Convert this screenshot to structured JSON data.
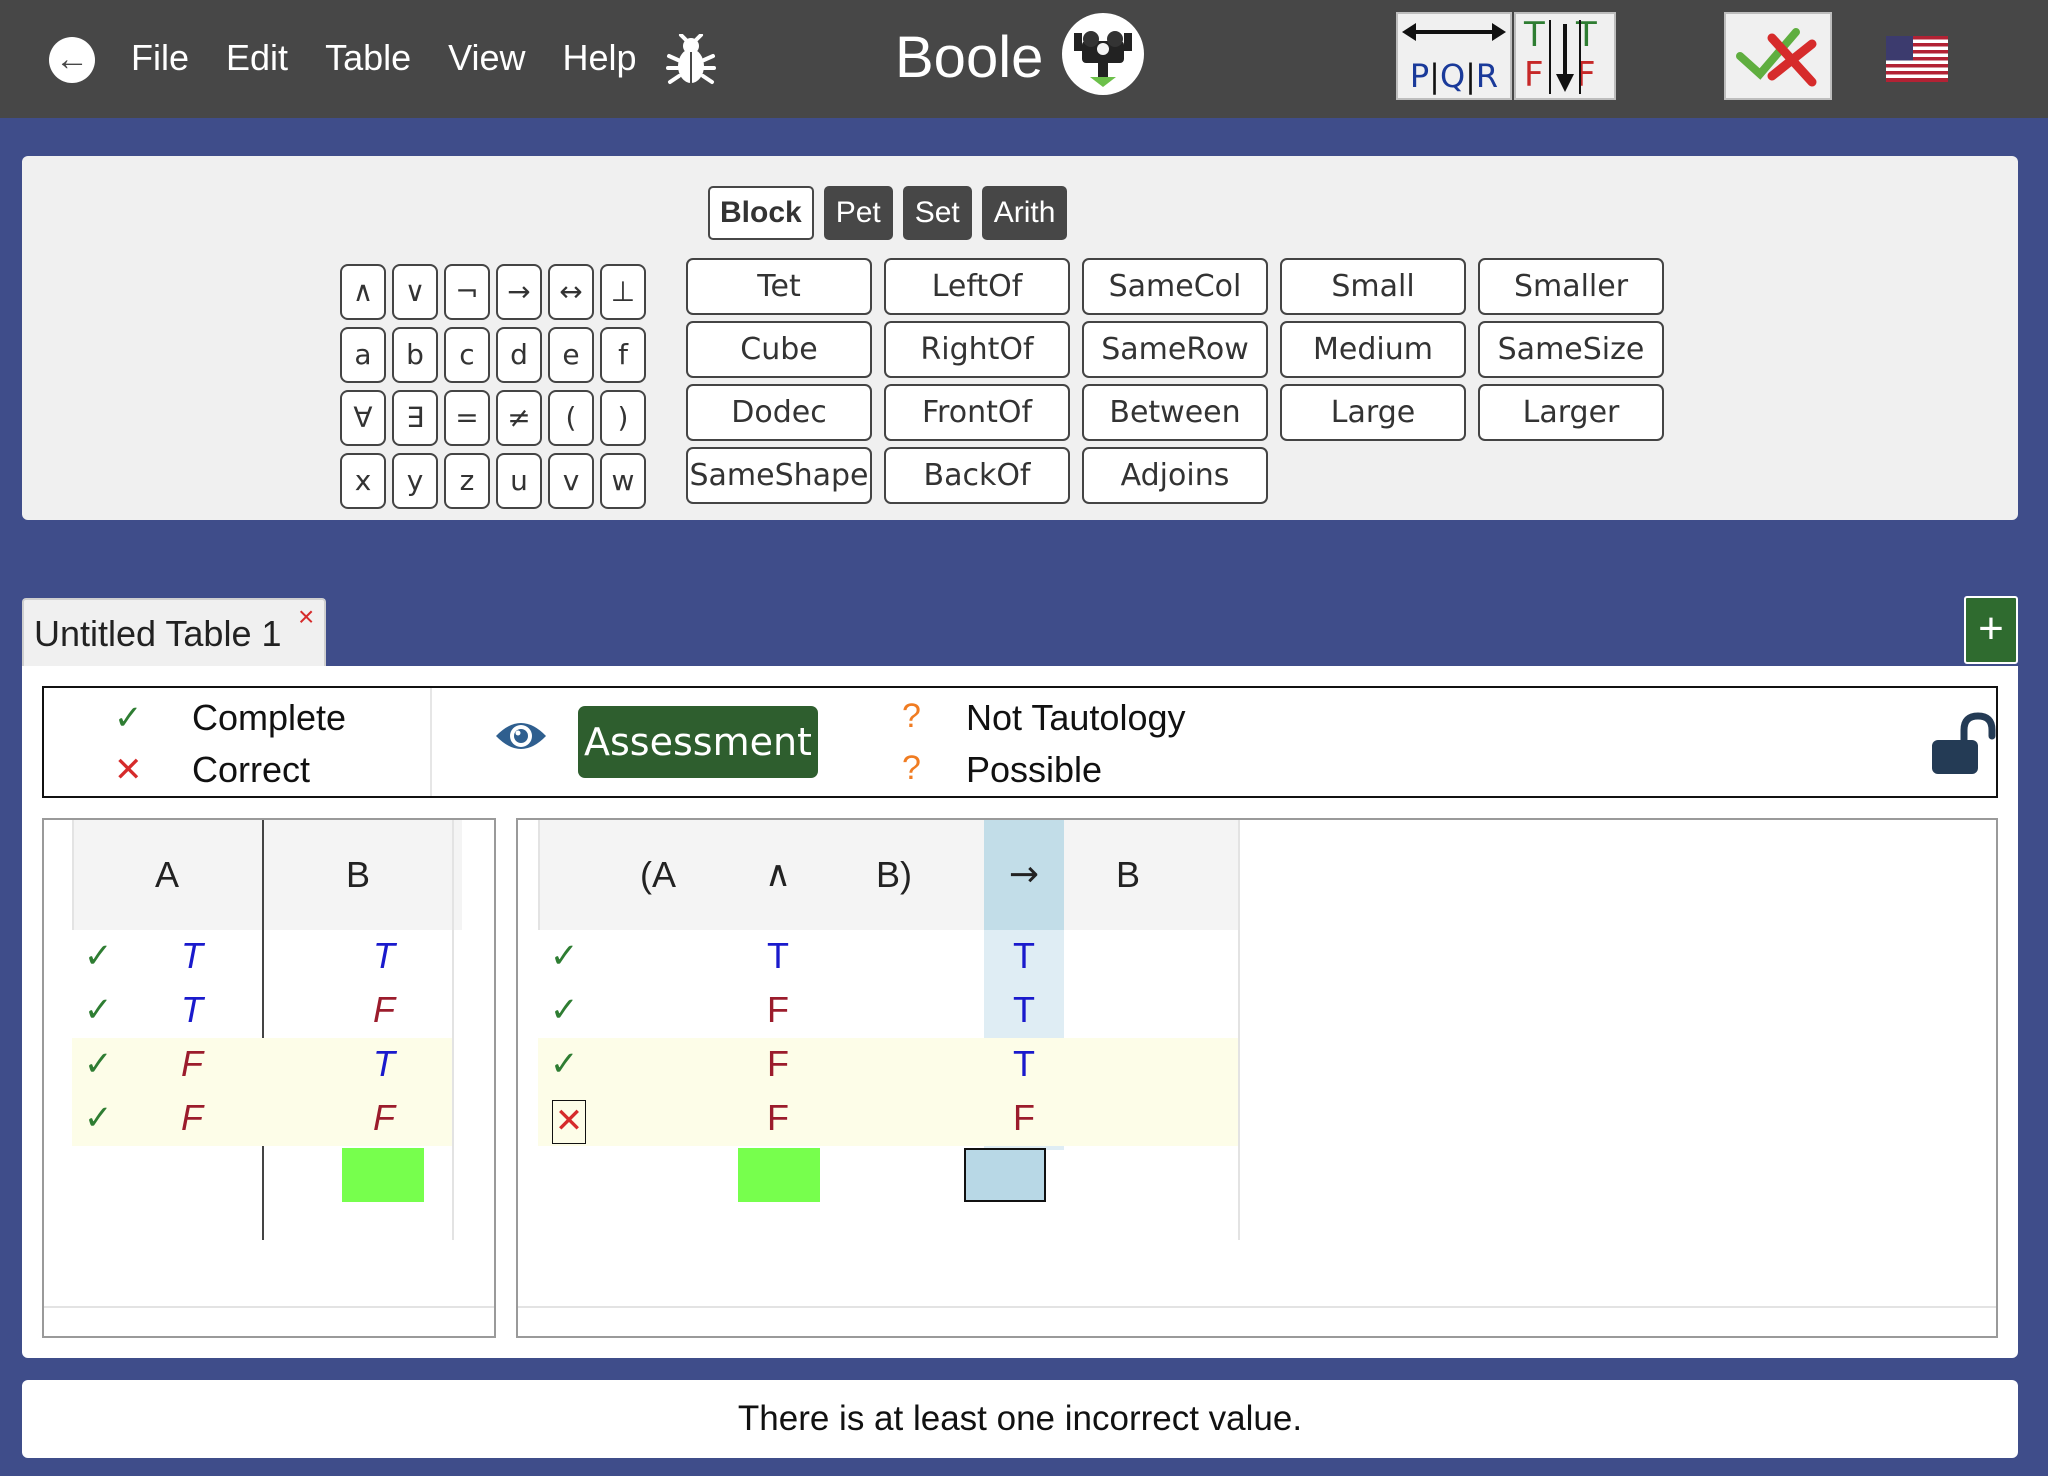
{
  "menu": [
    "File",
    "Edit",
    "Table",
    "View",
    "Help"
  ],
  "app": {
    "title": "Boole"
  },
  "toolbar": {
    "columns_icon_letters": [
      "P",
      "Q",
      "R"
    ],
    "fill_icon_letters": {
      "top": [
        "T",
        "T"
      ],
      "bottom": [
        "F",
        "F"
      ]
    }
  },
  "keyboard": {
    "language_tabs": [
      {
        "label": "Block",
        "active": true
      },
      {
        "label": "Pet",
        "active": false
      },
      {
        "label": "Set",
        "active": false
      },
      {
        "label": "Arith",
        "active": false
      }
    ],
    "symbols": [
      "∧",
      "∨",
      "¬",
      "→",
      "↔",
      "⊥",
      "a",
      "b",
      "c",
      "d",
      "e",
      "f",
      "∀",
      "∃",
      "=",
      "≠",
      "(",
      ")",
      "x",
      "y",
      "z",
      "u",
      "v",
      "w"
    ],
    "predicates": [
      "Tet",
      "LeftOf",
      "SameCol",
      "Small",
      "Smaller",
      "Cube",
      "RightOf",
      "SameRow",
      "Medium",
      "SameSize",
      "Dodec",
      "FrontOf",
      "Between",
      "Large",
      "Larger",
      "SameShape",
      "BackOf",
      "Adjoins"
    ]
  },
  "tab": {
    "label": "Untitled Table 1",
    "close_glyph": "×",
    "add_glyph": "+"
  },
  "status": {
    "complete_label": "Complete",
    "correct_label": "Correct",
    "assessment_label": "Assessment",
    "tautology_label": "Not Tautology",
    "possible_label": "Possible",
    "question_glyph": "?"
  },
  "reference_table": {
    "headers": [
      "A",
      "B"
    ],
    "rows": [
      [
        "T",
        "T"
      ],
      [
        "T",
        "F"
      ],
      [
        "F",
        "T"
      ],
      [
        "F",
        "F"
      ]
    ],
    "row_status": [
      "check",
      "check",
      "check",
      "check"
    ]
  },
  "formula_table": {
    "tokens": [
      "(A",
      "∧",
      "B)",
      "→",
      "B"
    ],
    "conj_values": [
      "T",
      "F",
      "F",
      "F"
    ],
    "main_values": [
      "T",
      "T",
      "T",
      "F"
    ],
    "row_status": [
      "check",
      "check",
      "check",
      "cross"
    ]
  },
  "message": "There is at least one incorrect value.",
  "colors": {
    "background": "#3f4d8a",
    "topbar": "#474747",
    "assessment_button": "#2e5e2e",
    "true_value": "#1a1acc",
    "false_value": "#9b1c2c",
    "check": "#2e7d32",
    "cross": "#d62b2b",
    "question": "#f07c22",
    "highlight_green": "#77ff4d",
    "main_connective_column": "#b8d8e6"
  }
}
